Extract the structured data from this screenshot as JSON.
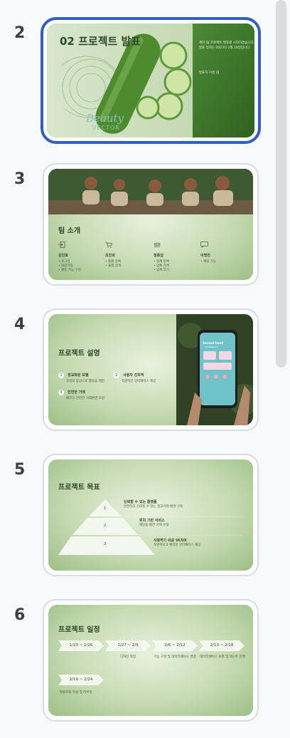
{
  "slides": [
    {
      "number": "2",
      "title": "02 프로젝트 발표",
      "side_text": "제의 DJ 프로젝트 발표를 시작하겠습니다. 발표 일자는 2023년 2월 28일입니다.",
      "presenter": "발표자 이름 DJ",
      "logo_line1": "Beauty",
      "logo_line2": "VECTOR"
    },
    {
      "number": "3",
      "title": "팀 소개",
      "members": [
        {
          "icon": "login-icon",
          "name": "김진호",
          "items": [
            "로그인",
            "회원가입",
            "활동 가능 구현"
          ]
        },
        {
          "icon": "cart-icon",
          "name": "조진희",
          "items": [
            "물품 등록",
            "물품 검색"
          ]
        },
        {
          "icon": "burger-icon",
          "name": "정종섭",
          "items": [
            "업체 등록",
            "업체 검색",
            "업체 후기"
          ]
        },
        {
          "icon": "sms-icon",
          "name": "이명진",
          "items": [
            "채팅 기능"
          ]
        }
      ]
    },
    {
      "number": "4",
      "title": "프로젝트 설명",
      "points": [
        {
          "n": "1",
          "head": "정교화된 모델",
          "sub": "유저의 등급으로 활동을 제한"
        },
        {
          "n": "2",
          "head": "사용자 친화적",
          "sub": "직관적인 인터페이스 제공"
        },
        {
          "n": "3",
          "head": "안전한 거래",
          "sub": "빠르고 안전한 거래환경 조성"
        }
      ],
      "phone_title": "Second-hand",
      "phone_sub": "marketplace"
    },
    {
      "number": "5",
      "title": "프로젝트 목표",
      "goals": [
        {
          "n": "1",
          "head": "신뢰할 수 있는 플랫폼",
          "sub": "안전하고 신뢰할 수 있는 중고거래 환경 구축"
        },
        {
          "n": "2",
          "head": "위치 기반 서비스",
          "sub": "해당을 통한 거래 유형"
        },
        {
          "n": "3",
          "head": "사용하기 쉬운 UI/UX",
          "sub": "직관적이고 편리한 인터페이스 제공"
        }
      ]
    },
    {
      "number": "6",
      "title": "프로젝트 일정",
      "schedule": [
        {
          "range": "1/23 ~ 1/26",
          "desc": ""
        },
        {
          "range": "1/27 ~ 2/5",
          "desc": "디자인 작업"
        },
        {
          "range": "2/6 ~ 2/12",
          "desc": "기능 구현 및 데이터베이스 연결"
        },
        {
          "range": "2/13 ~ 2/18",
          "desc": "데이터베이스 보완 및 테스트 진행"
        }
      ],
      "schedule_last": {
        "range": "2/19 ~ 2/24",
        "desc": "발표자료 작성 및 마무리"
      }
    }
  ],
  "colors": {
    "selection": "#2f5ec8",
    "frame_border": "#dadce0",
    "scroll_thumb": "#dadce0"
  }
}
